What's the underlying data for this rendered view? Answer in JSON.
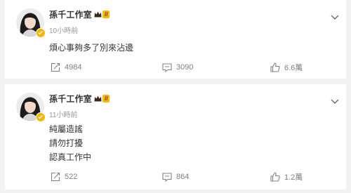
{
  "posts": [
    {
      "author": "孫千工作室",
      "level_badge": "II",
      "time": "10小時前",
      "text_lines": [
        "煩心事夠多了別來沾邊"
      ],
      "reposts": "4984",
      "comments": "3090",
      "likes": "6.6萬"
    },
    {
      "author": "孫千工作室",
      "level_badge": "II",
      "time": "11小時前",
      "text_lines": [
        "純屬造謠",
        "請勿打擾",
        "認真工作中"
      ],
      "reposts": "522",
      "comments": "864",
      "likes": "1.2萬"
    }
  ],
  "colors": {
    "background": "#f2f2f2",
    "card": "#ffffff",
    "name": "#333333",
    "meta": "#999999",
    "verified_badge": "#f7b500",
    "level_badge": "#f6b70f"
  },
  "icons": [
    "avatar",
    "verified-icon",
    "crown-icon",
    "chevron-down-icon",
    "repost-icon",
    "comment-icon",
    "like-icon"
  ]
}
